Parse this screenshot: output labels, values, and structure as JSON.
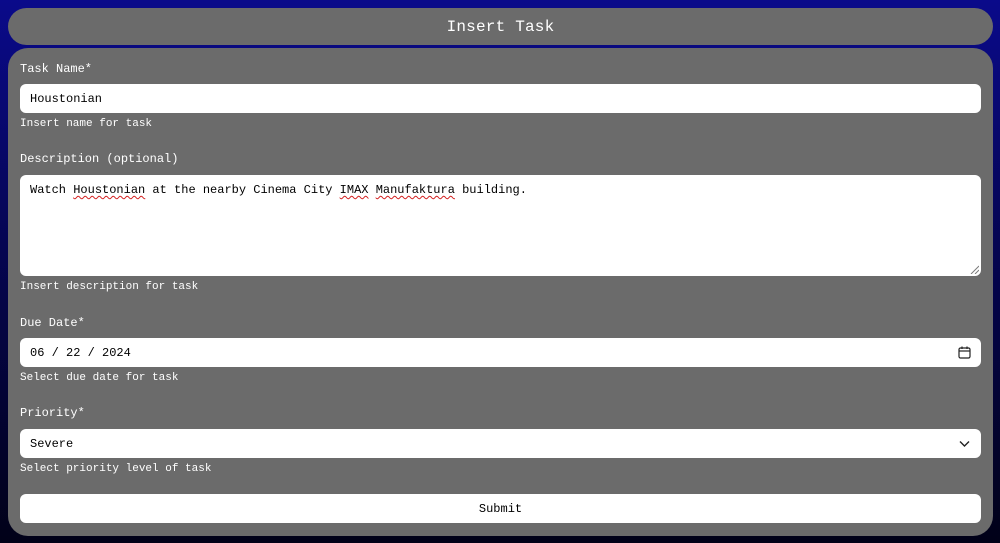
{
  "header": {
    "title": "Insert Task"
  },
  "form": {
    "task_name": {
      "label": "Task Name*",
      "value": "Houstonian",
      "hint": "Insert name for task"
    },
    "description": {
      "label": "Description (optional)",
      "value_parts": [
        "Watch ",
        "Houstonian",
        " at the nearby Cinema City ",
        "IMAX",
        " ",
        "Manufaktura",
        " building."
      ],
      "hint": "Insert description for task"
    },
    "due_date": {
      "label": "Due Date*",
      "value": "06 / 22 / 2024",
      "hint": "Select due date for task",
      "icon": "calendar-icon"
    },
    "priority": {
      "label": "Priority*",
      "value": "Severe",
      "hint": "Select priority level of task",
      "icon": "chevron-down-icon"
    },
    "submit_label": "Submit"
  },
  "colors": {
    "background_top": "#0a0a8a",
    "background_bottom": "#010118",
    "panel": "#6b6b6b",
    "spellcheck": "#d21f1f"
  }
}
